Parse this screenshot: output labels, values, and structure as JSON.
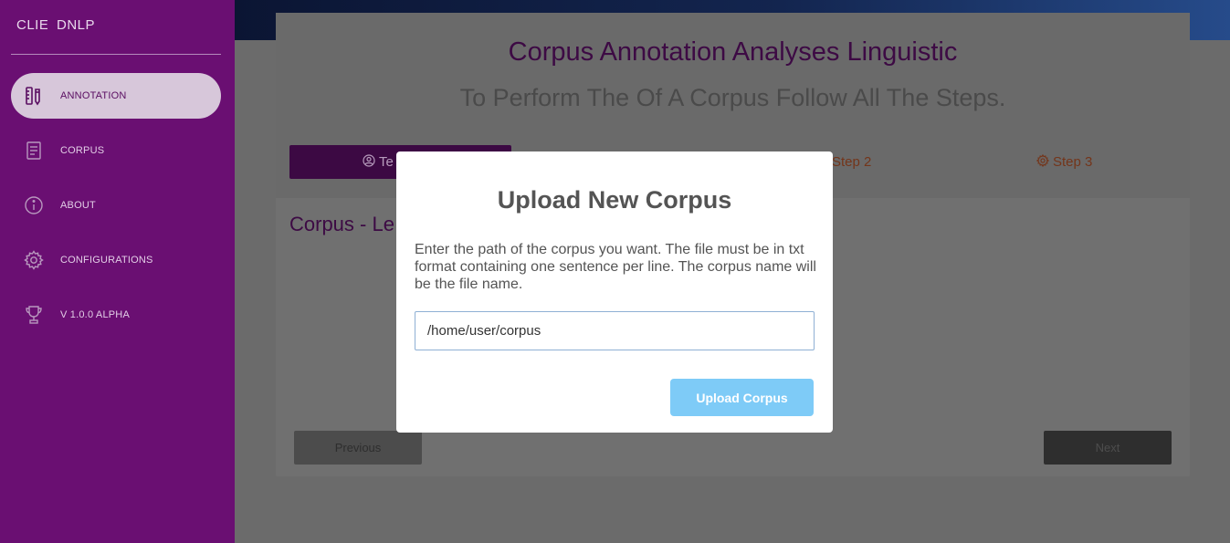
{
  "sidebar": {
    "brand_part1": "CLIENT",
    "brand_part2": "DNLP",
    "items": [
      {
        "label": "ANNOTATION",
        "icon": "ruler-pencil-icon",
        "active": true
      },
      {
        "label": "CORPUS",
        "icon": "document-icon",
        "active": false
      },
      {
        "label": "ABOUT",
        "icon": "info-icon",
        "active": false
      },
      {
        "label": "CONFIGURATIONS",
        "icon": "gear-icon",
        "active": false
      },
      {
        "label": "V 1.0.0 ALPHA",
        "icon": "trophy-icon",
        "active": false
      }
    ]
  },
  "card": {
    "title": "Corpus Annotation Analyses Linguistic",
    "subtitle": "To Perform The Of A Corpus Follow All The Steps.",
    "steps": [
      {
        "label": "Te",
        "icon": "user-circle-icon"
      },
      {
        "label": "Step 2",
        "icon": ""
      },
      {
        "label": "Step 3",
        "icon": "gear-icon"
      }
    ],
    "section_title": "Corpus - Le",
    "prev_label": "Previous",
    "next_label": "Next"
  },
  "modal": {
    "title": "Upload New Corpus",
    "description": "Enter the path of the corpus you want. The file must be in txt format containing one sentence per line. The corpus name will be the file name.",
    "input_value": "/home/user/corpus",
    "button_label": "Upload Corpus"
  },
  "colors": {
    "sidebar_bg": "#6a0f72",
    "accent_purple": "#3d0a44",
    "button_blue": "#7ecbf7"
  }
}
